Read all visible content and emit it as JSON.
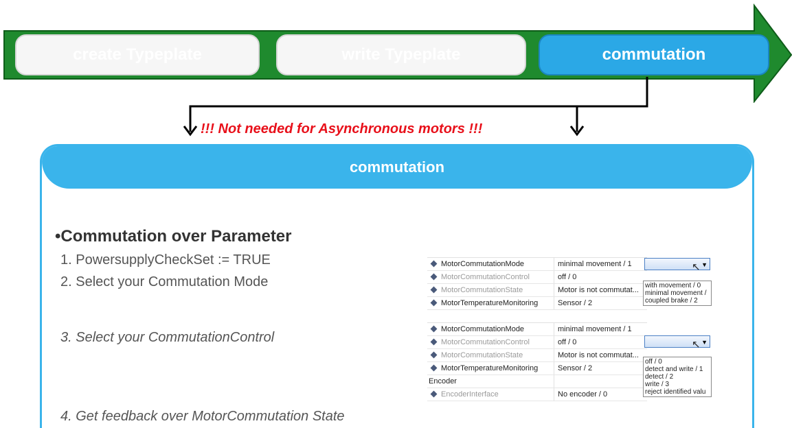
{
  "process": {
    "steps": [
      {
        "label": "create Typeplate",
        "active": false
      },
      {
        "label": "write Typeplate",
        "active": false
      },
      {
        "label": "commutation",
        "active": true
      }
    ]
  },
  "warning": "!!! Not needed for Asynchronous motors !!!",
  "panel": {
    "title": "commutation",
    "heading": "•Commutation over Parameter",
    "steps": [
      "1. PowersupplyCheckSet := TRUE",
      "2. Select your Commutation Mode",
      "3. Select your CommutationControl",
      "4. Get feedback over MotorCommutation State"
    ]
  },
  "table1": {
    "rows": [
      {
        "name": "MotorCommutationMode",
        "value": "minimal movement / 1",
        "dim": false
      },
      {
        "name": "MotorCommutationControl",
        "value": "off / 0",
        "dim": true
      },
      {
        "name": "MotorCommutationState",
        "value": "Motor is not commutat...",
        "dim": true
      },
      {
        "name": "MotorTemperatureMonitoring",
        "value": "Sensor / 2",
        "dim": false
      }
    ],
    "options": [
      "with movement / 0",
      "minimal movement /",
      "coupled brake / 2"
    ]
  },
  "table2": {
    "rows": [
      {
        "name": "MotorCommutationMode",
        "value": "minimal movement / 1",
        "dim": false
      },
      {
        "name": "MotorCommutationControl",
        "value": "off / 0",
        "dim": true
      },
      {
        "name": "MotorCommutationState",
        "value": "Motor is not commutat...",
        "dim": true
      },
      {
        "name": "MotorTemperatureMonitoring",
        "value": "Sensor / 2",
        "dim": false
      },
      {
        "name": "Encoder",
        "value": "",
        "group": true
      },
      {
        "name": "EncoderInterface",
        "value": "No encoder / 0",
        "dim": true
      }
    ],
    "options": [
      "off / 0",
      "detect and write / 1",
      "detect  / 2",
      "write / 3",
      "reject identified valu"
    ]
  },
  "colors": {
    "arrow_green": "#1f8a2e",
    "active_blue": "#2ba8e6",
    "panel_blue": "#3ab4eb",
    "warning_red": "#e8101a"
  }
}
